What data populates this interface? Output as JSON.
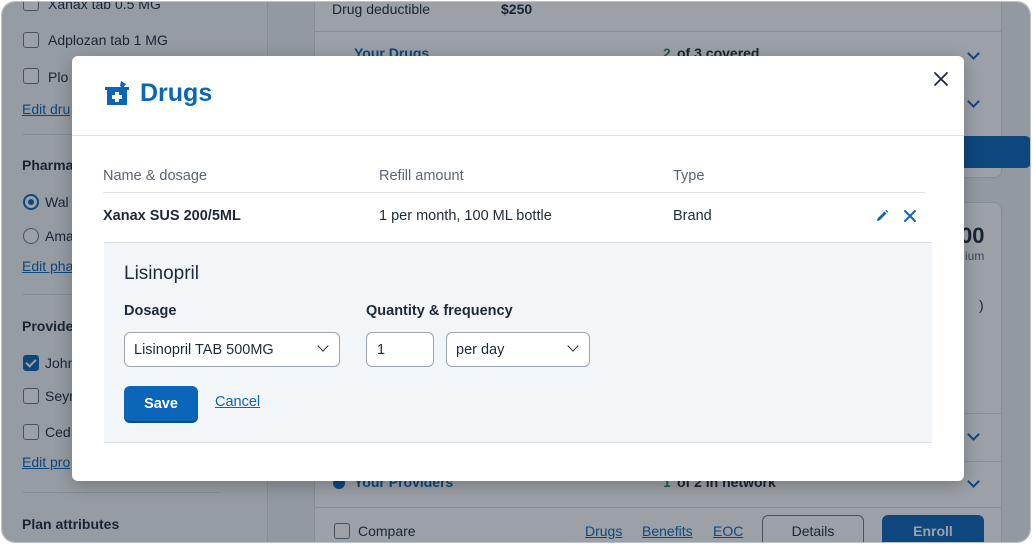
{
  "background": {
    "sidebar": {
      "drug_items": [
        "Xanax tab 0.5 MG",
        "Adplozan tab 1 MG",
        "Plo"
      ],
      "edit_drugs_link": "Edit dru",
      "pharmacy_heading": "Pharma",
      "pharmacy_items": [
        "Wal",
        "Ama"
      ],
      "edit_pharmacy_link": "Edit pha",
      "providers_heading": "Provide",
      "provider_items": [
        "John",
        "Seym",
        "Ced"
      ],
      "edit_providers_link": "Edit pro",
      "plan_attributes_heading": "Plan attributes"
    },
    "main": {
      "drug_deductible_label": "Drug deductible",
      "drug_deductible_value": "$250",
      "your_drugs_label": "Your Drugs",
      "your_drugs_status_count": "2",
      "your_drugs_status_text": "of 3 covered",
      "premium_amount_partial": "00",
      "premium_label_partial": "ium",
      "paren_partial": ")",
      "your_providers_label": "Your Providers",
      "your_providers_status_count": "1",
      "your_providers_status_text": "of 2 in network",
      "compare_label": "Compare",
      "footer_links": [
        "Drugs",
        "Benefits",
        "EOC"
      ],
      "details_button": "Details",
      "enroll_button": "Enroll"
    }
  },
  "modal": {
    "title": "Drugs",
    "title_icon": "prescription-bottle-icon",
    "close_icon": "close-icon",
    "table": {
      "headers": [
        "Name & dosage",
        "Refill amount",
        "Type"
      ],
      "rows": [
        {
          "name": "Xanax SUS 200/5ML",
          "refill": "1 per month, 100 ML bottle",
          "type": "Brand",
          "actions": [
            "edit-icon",
            "remove-icon"
          ]
        }
      ]
    },
    "edit_form": {
      "drug_name": "Lisinopril",
      "dosage_label": "Dosage",
      "dosage_selected": "Lisinopril TAB 500MG",
      "quantity_label": "Quantity & frequency",
      "quantity_value": "1",
      "frequency_selected": "per day",
      "save_label": "Save",
      "cancel_label": "Cancel"
    }
  },
  "colors": {
    "accent": "#0b65b8",
    "overlay": "rgba(20,30,45,0.42)",
    "covered_count": "#2e8b57"
  }
}
